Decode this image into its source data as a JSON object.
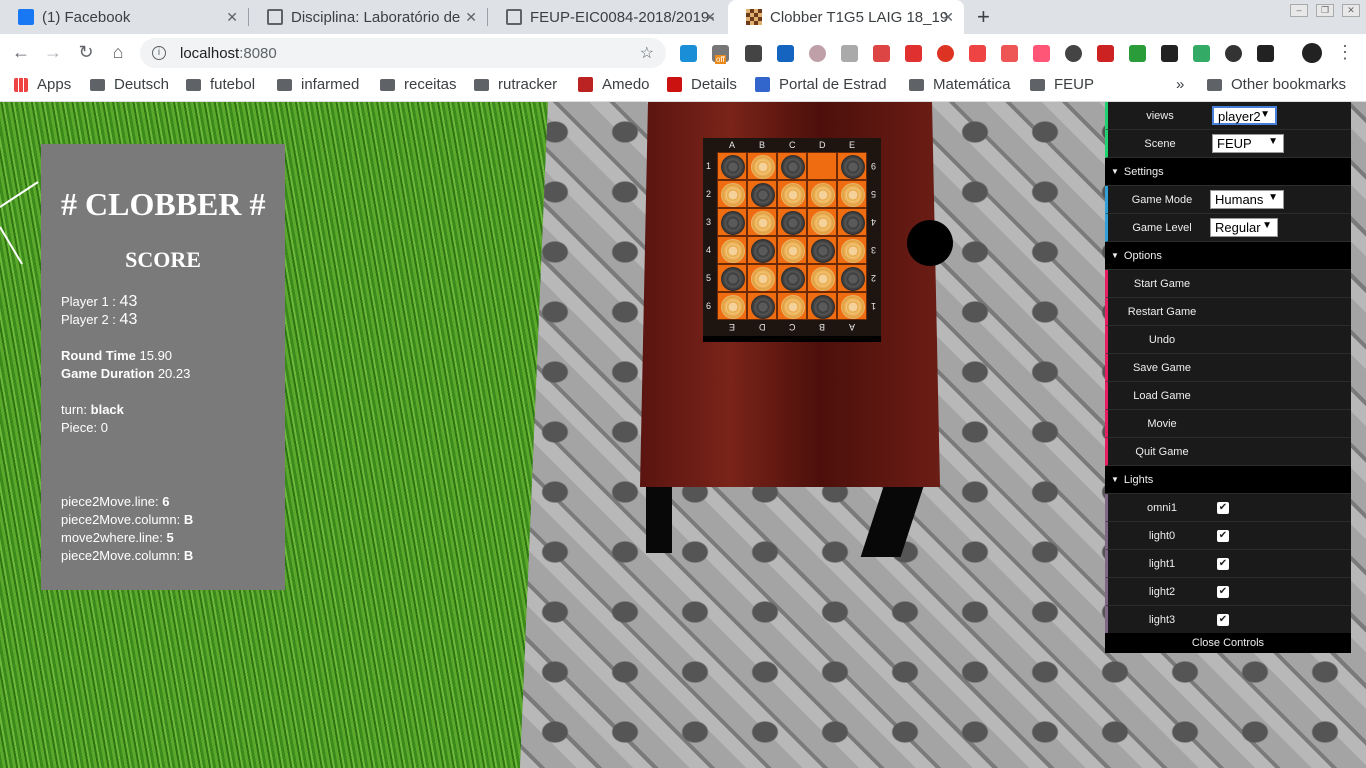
{
  "tabs": [
    {
      "title": "(1) Facebook",
      "icon": "facebook-icon"
    },
    {
      "title": "Disciplina: Laboratório de",
      "icon": "university-icon"
    },
    {
      "title": "FEUP-EIC0084-2018/2019-",
      "icon": "university-icon"
    },
    {
      "title": "Clobber T1G5 LAIG 18_19",
      "icon": "checkerboard-icon"
    }
  ],
  "address": {
    "host": "localhost",
    "port": ":8080"
  },
  "extensions": [
    "off"
  ],
  "bookmarks": [
    "Apps",
    "Deutsch",
    "futebol",
    "infarmed",
    "receitas",
    "rutracker",
    "Amedo",
    "Details",
    "Portal de Estrad",
    "Matemática",
    "FEUP",
    "»",
    "Other bookmarks"
  ],
  "score_panel": {
    "title": "# CLOBBER #",
    "score_heading": "SCORE",
    "player1_label": "Player 1 :",
    "player1_score": "43",
    "player2_label": "Player 2 :",
    "player2_score": "43",
    "round_time_label": "Round Time",
    "round_time": "15.90",
    "game_duration_label": "Game Duration",
    "game_duration": "20.23",
    "turn_label": "turn:",
    "turn": "black",
    "piece_label": "Piece:",
    "piece": "0",
    "p2m_line_label": "piece2Move.line:",
    "p2m_line": "6",
    "p2m_col_label": "piece2Move.column:",
    "p2m_col": "B",
    "m2w_line_label": "move2where.line:",
    "m2w_line": "5",
    "p2m_col2_label": "piece2Move.column:",
    "p2m_col2": "B"
  },
  "board": {
    "columns": [
      "A",
      "B",
      "C",
      "D",
      "E"
    ],
    "bottom_columns": [
      "E",
      "D",
      "C",
      "B",
      "A"
    ],
    "rows": [
      "1",
      "2",
      "3",
      "4",
      "5",
      "6"
    ],
    "right_rows": [
      "9",
      "5",
      "4",
      "3",
      "2",
      "1"
    ],
    "cells": [
      [
        "black",
        "white",
        "black",
        "empty",
        "black"
      ],
      [
        "white",
        "black",
        "white",
        "white",
        "white"
      ],
      [
        "black",
        "white",
        "black",
        "white",
        "black"
      ],
      [
        "white",
        "black",
        "white",
        "black",
        "white"
      ],
      [
        "black",
        "white",
        "black",
        "white",
        "black"
      ],
      [
        "white",
        "black",
        "white",
        "black",
        "white"
      ]
    ],
    "colors": {
      "square": "#f06c10",
      "frame": "#1e1410"
    }
  },
  "controls": {
    "views_label": "views",
    "views_value": "player2",
    "scene_label": "Scene",
    "scene_value": "FEUP",
    "settings_label": "Settings",
    "game_mode_label": "Game Mode",
    "game_mode_value": "Humans",
    "game_level_label": "Game Level",
    "game_level_value": "Regular",
    "options_label": "Options",
    "options": [
      "Start Game",
      "Restart Game",
      "Undo",
      "Save Game",
      "Load Game",
      "Movie",
      "Quit Game"
    ],
    "lights_label": "Lights",
    "lights": [
      {
        "name": "omni1",
        "checked": true
      },
      {
        "name": "light0",
        "checked": true
      },
      {
        "name": "light1",
        "checked": true
      },
      {
        "name": "light2",
        "checked": true
      },
      {
        "name": "light3",
        "checked": true
      }
    ],
    "close_label": "Close Controls",
    "accent_colors": {
      "views": "#1ed36f",
      "settings": "#2fa1d6",
      "options": "#e61d5f",
      "lights": "#806787"
    }
  }
}
